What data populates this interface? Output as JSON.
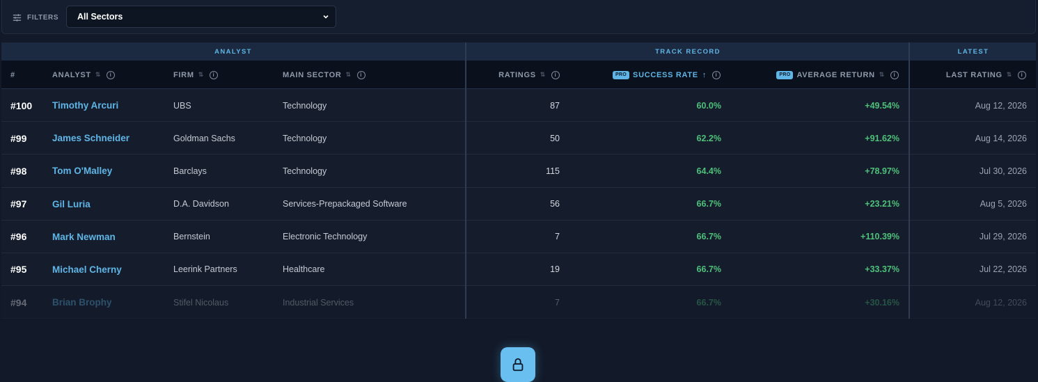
{
  "filters": {
    "label": "FILTERS",
    "sector_select": {
      "value": "All Sectors"
    }
  },
  "groups": {
    "analyst": "ANALYST",
    "track_record": "TRACK RECORD",
    "latest": "LATEST"
  },
  "columns": {
    "rank": "#",
    "analyst": "ANALYST",
    "firm": "FIRM",
    "main_sector": "MAIN SECTOR",
    "ratings": "RATINGS",
    "success_rate": "SUCCESS RATE",
    "average_return": "AVERAGE RETURN",
    "last_rating": "LAST RATING",
    "pro_badge": "PRO",
    "sort_active_icon": "↑",
    "sort_icon": "⇅",
    "info_icon": "i"
  },
  "rows": [
    {
      "rank": "#100",
      "analyst": "Timothy Arcuri",
      "firm": "UBS",
      "sector": "Technology",
      "ratings": "87",
      "success_rate": "60.0%",
      "average_return": "+49.54%",
      "last_rating": "Aug 12, 2026"
    },
    {
      "rank": "#99",
      "analyst": "James Schneider",
      "firm": "Goldman Sachs",
      "sector": "Technology",
      "ratings": "50",
      "success_rate": "62.2%",
      "average_return": "+91.62%",
      "last_rating": "Aug 14, 2026"
    },
    {
      "rank": "#98",
      "analyst": "Tom O'Malley",
      "firm": "Barclays",
      "sector": "Technology",
      "ratings": "115",
      "success_rate": "64.4%",
      "average_return": "+78.97%",
      "last_rating": "Jul 30, 2026"
    },
    {
      "rank": "#97",
      "analyst": "Gil Luria",
      "firm": "D.A. Davidson",
      "sector": "Services-Prepackaged Software",
      "ratings": "56",
      "success_rate": "66.7%",
      "average_return": "+23.21%",
      "last_rating": "Aug 5, 2026"
    },
    {
      "rank": "#96",
      "analyst": "Mark Newman",
      "firm": "Bernstein",
      "sector": "Electronic Technology",
      "ratings": "7",
      "success_rate": "66.7%",
      "average_return": "+110.39%",
      "last_rating": "Jul 29, 2026"
    },
    {
      "rank": "#95",
      "analyst": "Michael Cherny",
      "firm": "Leerink Partners",
      "sector": "Healthcare",
      "ratings": "19",
      "success_rate": "66.7%",
      "average_return": "+33.37%",
      "last_rating": "Jul 22, 2026"
    },
    {
      "rank": "#94",
      "analyst": "Brian Brophy",
      "firm": "Stifel Nicolaus",
      "sector": "Industrial Services",
      "ratings": "7",
      "success_rate": "66.7%",
      "average_return": "+30.16%",
      "last_rating": "Aug 12, 2026"
    }
  ],
  "colors": {
    "accent": "#5fb5e6",
    "positive": "#4ec07a",
    "background": "#121a29"
  }
}
